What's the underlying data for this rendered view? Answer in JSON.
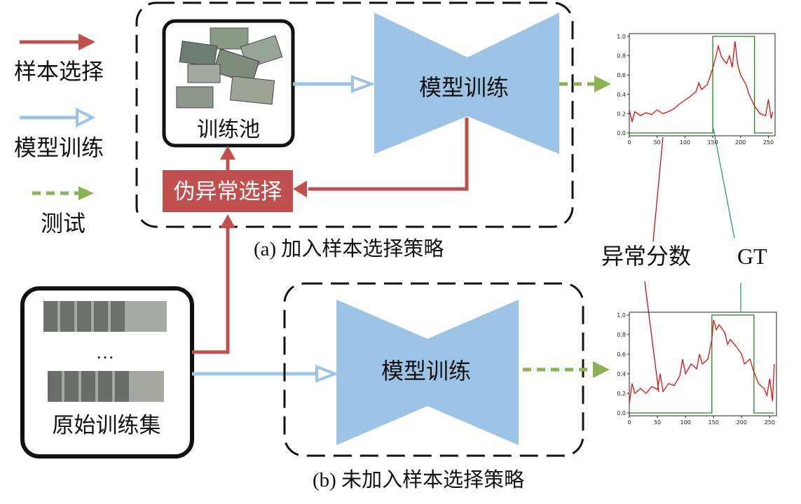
{
  "legend": {
    "sample_selection": "样本选择",
    "model_training": "模型训练",
    "testing": "测试"
  },
  "top_panel": {
    "training_pool": "训练池",
    "pseudo_anomaly_selection": "伪异常选择",
    "model_label": "模型训练",
    "caption": "(a) 加入样本选择策略"
  },
  "bottom_panel": {
    "model_label": "模型训练",
    "caption": "(b) 未加入样本选择策略"
  },
  "dataset": {
    "label": "原始训练集",
    "ellipsis": "…"
  },
  "annotations": {
    "anomaly_score": "异常分数",
    "gt": "GT"
  },
  "colors": {
    "selection_arrow": "#c0504d",
    "training_arrow": "#9dc3e6",
    "testing_arrow": "#8db255",
    "model_fill": "#9dc3e6",
    "score_line": "#e01010",
    "gt_line": "#1a8a1a"
  },
  "chart_data": [
    {
      "type": "line",
      "xticks": [
        "0",
        "50",
        "100",
        "150",
        "200",
        "250"
      ],
      "yticks": [
        "0.0",
        "0.2",
        "0.4",
        "0.6",
        "0.8",
        "1.0"
      ],
      "xlim": [
        0,
        262
      ],
      "ylim": [
        0,
        1
      ],
      "series": [
        {
          "name": "GT",
          "points": [
            [
              0,
              0
            ],
            [
              150,
              0
            ],
            [
              150,
              1
            ],
            [
              225,
              1
            ],
            [
              225,
              0
            ],
            [
              258,
              0
            ]
          ]
        },
        {
          "name": "异常分数",
          "points": [
            [
              0,
              0.24
            ],
            [
              5,
              0.12
            ],
            [
              10,
              0.22
            ],
            [
              20,
              0.18
            ],
            [
              30,
              0.21
            ],
            [
              40,
              0.19
            ],
            [
              50,
              0.24
            ],
            [
              60,
              0.2
            ],
            [
              70,
              0.22
            ],
            [
              80,
              0.25
            ],
            [
              90,
              0.3
            ],
            [
              100,
              0.34
            ],
            [
              110,
              0.38
            ],
            [
              120,
              0.43
            ],
            [
              125,
              0.52
            ],
            [
              130,
              0.45
            ],
            [
              140,
              0.5
            ],
            [
              145,
              0.58
            ],
            [
              150,
              0.67
            ],
            [
              155,
              0.78
            ],
            [
              160,
              0.9
            ],
            [
              165,
              0.8
            ],
            [
              170,
              0.75
            ],
            [
              175,
              0.72
            ],
            [
              180,
              0.8
            ],
            [
              185,
              0.68
            ],
            [
              190,
              0.95
            ],
            [
              195,
              0.7
            ],
            [
              200,
              0.6
            ],
            [
              205,
              0.55
            ],
            [
              210,
              0.5
            ],
            [
              215,
              0.4
            ],
            [
              225,
              0.28
            ],
            [
              235,
              0.2
            ],
            [
              245,
              0.18
            ],
            [
              250,
              0.35
            ],
            [
              255,
              0.15
            ],
            [
              258,
              0.22
            ]
          ]
        }
      ]
    },
    {
      "type": "line",
      "xticks": [
        "0",
        "50",
        "100",
        "150",
        "200",
        "250"
      ],
      "yticks": [
        "0.0",
        "0.2",
        "0.4",
        "0.6",
        "0.8",
        "1.0"
      ],
      "xlim": [
        0,
        262
      ],
      "ylim": [
        0,
        1
      ],
      "series": [
        {
          "name": "GT",
          "points": [
            [
              0,
              0
            ],
            [
              147,
              0
            ],
            [
              147,
              1
            ],
            [
              222,
              1
            ],
            [
              222,
              0
            ],
            [
              258,
              0
            ]
          ]
        },
        {
          "name": "异常分数",
          "points": [
            [
              0,
              0.1
            ],
            [
              5,
              0.3
            ],
            [
              10,
              0.2
            ],
            [
              20,
              0.25
            ],
            [
              30,
              0.2
            ],
            [
              40,
              0.27
            ],
            [
              50,
              0.24
            ],
            [
              55,
              0.4
            ],
            [
              60,
              0.22
            ],
            [
              70,
              0.3
            ],
            [
              80,
              0.28
            ],
            [
              90,
              0.38
            ],
            [
              95,
              0.55
            ],
            [
              100,
              0.4
            ],
            [
              110,
              0.5
            ],
            [
              120,
              0.45
            ],
            [
              125,
              0.6
            ],
            [
              130,
              0.5
            ],
            [
              140,
              0.55
            ],
            [
              147,
              0.75
            ],
            [
              150,
              0.95
            ],
            [
              155,
              0.85
            ],
            [
              160,
              0.9
            ],
            [
              170,
              0.82
            ],
            [
              175,
              0.7
            ],
            [
              180,
              0.75
            ],
            [
              190,
              0.68
            ],
            [
              200,
              0.6
            ],
            [
              205,
              0.5
            ],
            [
              215,
              0.55
            ],
            [
              220,
              0.45
            ],
            [
              230,
              0.3
            ],
            [
              240,
              0.25
            ],
            [
              245,
              0.18
            ],
            [
              250,
              0.35
            ],
            [
              255,
              0.12
            ],
            [
              258,
              0.5
            ]
          ]
        }
      ]
    }
  ]
}
